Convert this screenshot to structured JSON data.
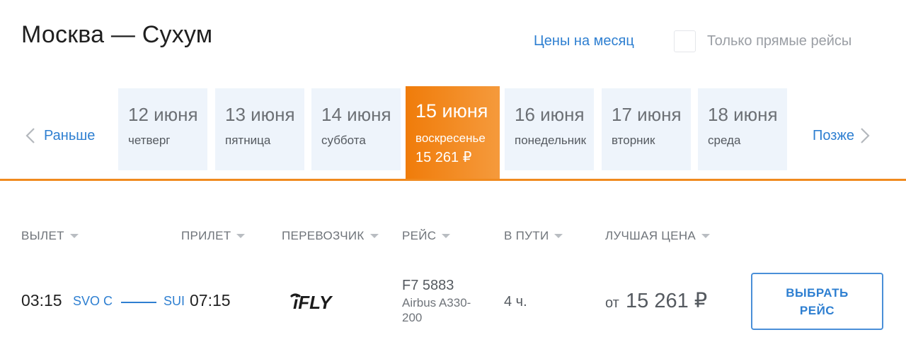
{
  "header": {
    "route_title": "Москва — Сухум",
    "month_prices_link": "Цены на месяц",
    "direct_only_label": "Только прямые рейсы",
    "direct_only_checked": false
  },
  "date_nav": {
    "prev_label": "Раньше",
    "next_label": "Позже",
    "days": [
      {
        "date": "12 июня",
        "weekday": "четверг"
      },
      {
        "date": "13 июня",
        "weekday": "пятница"
      },
      {
        "date": "14 июня",
        "weekday": "суббота"
      },
      {
        "date": "15 июня",
        "weekday": "воскресенье",
        "price": "15 261 ₽",
        "selected": true
      },
      {
        "date": "16 июня",
        "weekday": "понедельник"
      },
      {
        "date": "17 июня",
        "weekday": "вторник"
      },
      {
        "date": "18 июня",
        "weekday": "среда"
      }
    ]
  },
  "columns": {
    "departure": "ВЫЛЕТ",
    "arrival": "ПРИЛЕТ",
    "carrier": "ПЕРЕВОЗЧИК",
    "flight": "РЕЙС",
    "duration": "В ПУТИ",
    "best_price": "ЛУЧШАЯ ЦЕНА"
  },
  "flights": [
    {
      "dep_time": "03:15",
      "dep_airport": "SVO C",
      "arr_airport": "SUI",
      "arr_time": "07:15",
      "carrier_logo": "iFLY",
      "flight_number": "F7 5883",
      "aircraft": "Airbus A330-200",
      "duration": "4 ч.",
      "price_prefix": "от",
      "price": "15 261 ₽",
      "select_label_line1": "ВЫБРАТЬ",
      "select_label_line2": "РЕЙС"
    }
  ],
  "colors": {
    "accent_blue": "#2e7fd1",
    "accent_orange": "#f07c0a",
    "day_bg": "#eef4fb"
  },
  "icons": {
    "prev": "chevron-left-icon",
    "next": "chevron-right-icon",
    "sort": "caret-down-icon"
  }
}
